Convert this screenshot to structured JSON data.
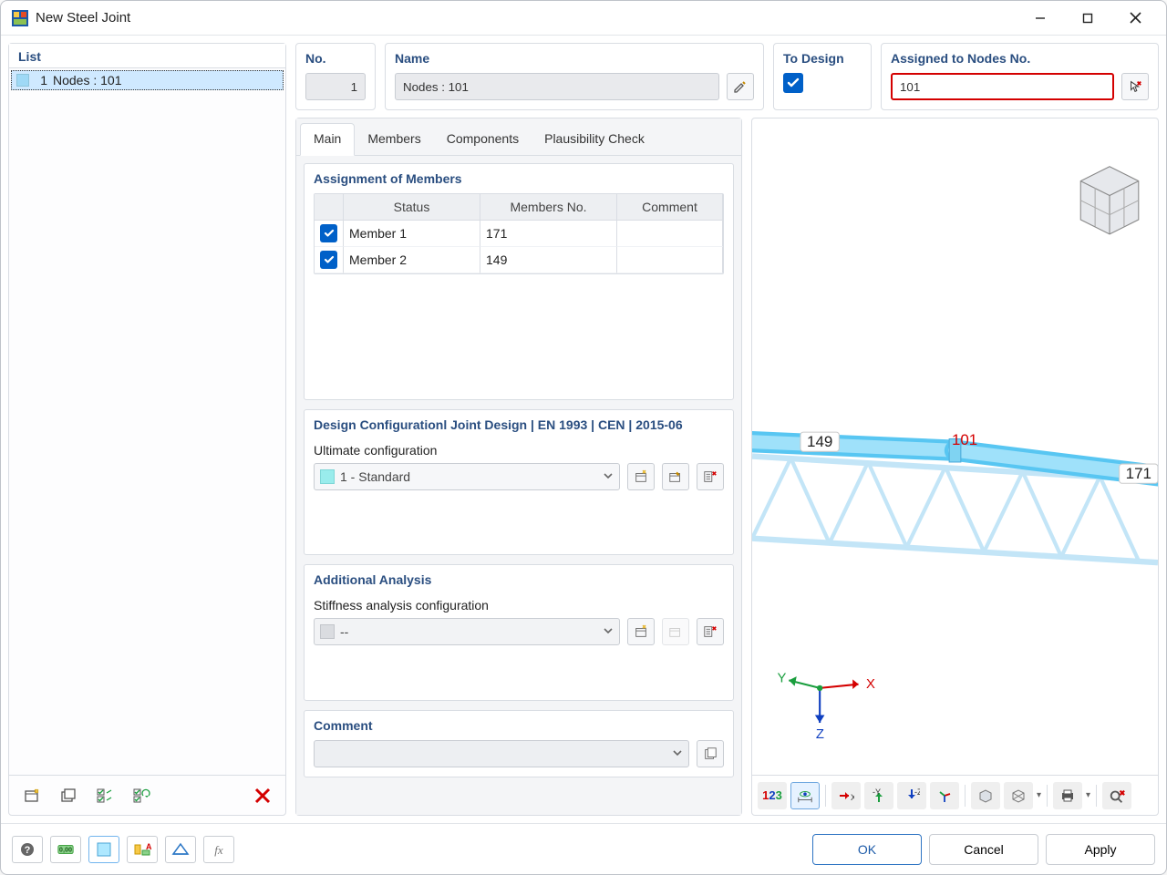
{
  "window": {
    "title": "New Steel Joint"
  },
  "list": {
    "header": "List",
    "items": [
      {
        "no": "1",
        "label": "Nodes : 101"
      }
    ]
  },
  "topRow": {
    "no": {
      "label": "No.",
      "value": "1"
    },
    "name": {
      "label": "Name",
      "value": "Nodes : 101"
    },
    "toDesign": {
      "label": "To Design",
      "checked": true
    },
    "assigned": {
      "label": "Assigned to Nodes No.",
      "value": "101"
    }
  },
  "tabs": [
    "Main",
    "Members",
    "Components",
    "Plausibility Check"
  ],
  "activeTab": 0,
  "assignment": {
    "title": "Assignment of Members",
    "columns": [
      "",
      "Status",
      "Members No.",
      "Comment"
    ],
    "rows": [
      {
        "checked": true,
        "status": "Member 1",
        "membersNo": "171",
        "comment": ""
      },
      {
        "checked": true,
        "status": "Member 2",
        "membersNo": "149",
        "comment": ""
      }
    ]
  },
  "designConfig": {
    "title": "Design Configurationl Joint Design | EN 1993 | CEN | 2015-06",
    "label": "Ultimate configuration",
    "value": "1 - Standard"
  },
  "additional": {
    "title": "Additional Analysis",
    "label": "Stiffness analysis configuration",
    "value": "--"
  },
  "comment": {
    "title": "Comment",
    "value": ""
  },
  "preview": {
    "node": "101",
    "member_left": "149",
    "member_right": "171",
    "axes": {
      "x": "X",
      "y": "Y",
      "z": "Z"
    }
  },
  "footer": {
    "ok": "OK",
    "cancel": "Cancel",
    "apply": "Apply"
  }
}
